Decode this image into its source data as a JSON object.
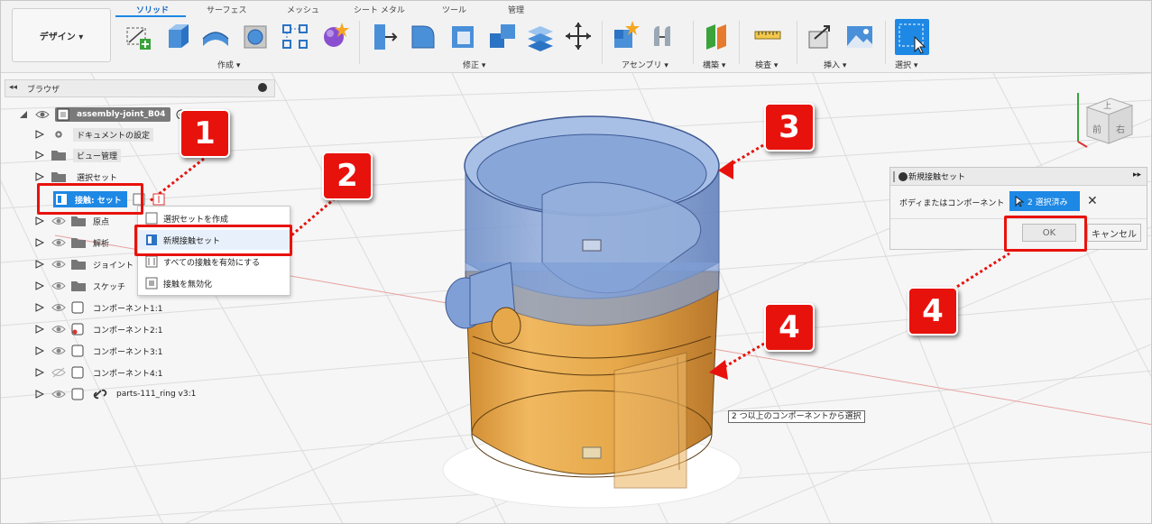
{
  "design_button": {
    "label": "デザイン ▾"
  },
  "tabs": [
    {
      "label": "ソリッド",
      "active": true
    },
    {
      "label": "サーフェス"
    },
    {
      "label": "メッシュ"
    },
    {
      "label": "シート メタル"
    },
    {
      "label": "ツール"
    },
    {
      "label": "管理"
    }
  ],
  "groups": {
    "create": "作成 ▾",
    "modify": "修正 ▾",
    "assemble": "アセンブリ ▾",
    "construct": "構築 ▾",
    "inspect": "検査 ▾",
    "insert": "挿入 ▾",
    "select": "選択 ▾"
  },
  "browser": {
    "title": "ブラウザ",
    "root": "assembly-joint_B04",
    "items": [
      {
        "label": "ドキュメントの設定"
      },
      {
        "label": "ビュー管理"
      },
      {
        "label": "選択セット"
      },
      {
        "label": "接触: セット"
      },
      {
        "label": "原点"
      },
      {
        "label": "解析"
      },
      {
        "label": "ジョイント"
      },
      {
        "label": "スケッチ"
      },
      {
        "label": "コンポーネント1:1"
      },
      {
        "label": "コンポーネント2:1"
      },
      {
        "label": "コンポーネント3:1"
      },
      {
        "label": "コンポーネント4:1"
      },
      {
        "label": "parts-111_ring v3:1"
      }
    ]
  },
  "context_menu": {
    "items": [
      {
        "label": "選択セットを作成"
      },
      {
        "label": "新規接触セット"
      },
      {
        "label": "すべての接触を有効にする"
      },
      {
        "label": "接触を無効化"
      }
    ]
  },
  "dialog": {
    "title": "新規接触セット",
    "field_label": "ボディまたはコンポーネント",
    "selection_label": "2 選択済み",
    "ok_label": "OK",
    "cancel_label": "キャンセル"
  },
  "tooltip": "2 つ以上のコンポーネントから選択",
  "callouts": [
    "1",
    "2",
    "3",
    "4",
    "4"
  ],
  "viewcube": {
    "top": "上",
    "front": "前",
    "right": "右"
  },
  "colors": {
    "accent": "#1e88e5",
    "callout": "#e8120c",
    "body": "#e6a84a",
    "lid": "#7f9fd6"
  }
}
